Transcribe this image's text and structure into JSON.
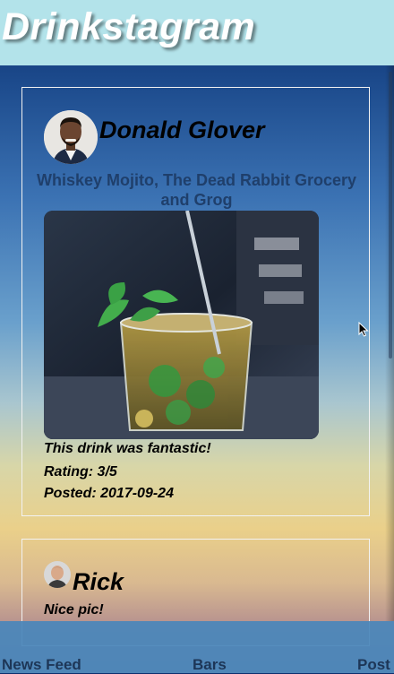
{
  "header": {
    "title": "Drinkstagram"
  },
  "feed": {
    "post": {
      "user_name": "Donald Glover",
      "drink_caption": "Whiskey Mojito, The Dead Rabbit Grocery and Grog",
      "comment": "This drink was fantastic!",
      "rating_line": "Rating: 3/5",
      "posted_line": "Posted: 2017-09-24"
    },
    "comment_card": {
      "user_name": "Rick",
      "text": "Nice pic!"
    }
  },
  "nav": {
    "news_feed": "News Feed",
    "bars": "Bars",
    "post": "Post"
  },
  "colors": {
    "header_bg": "#b3e3ea",
    "nav_bg": "#4a86ba",
    "caption": "#1f3f6b"
  }
}
